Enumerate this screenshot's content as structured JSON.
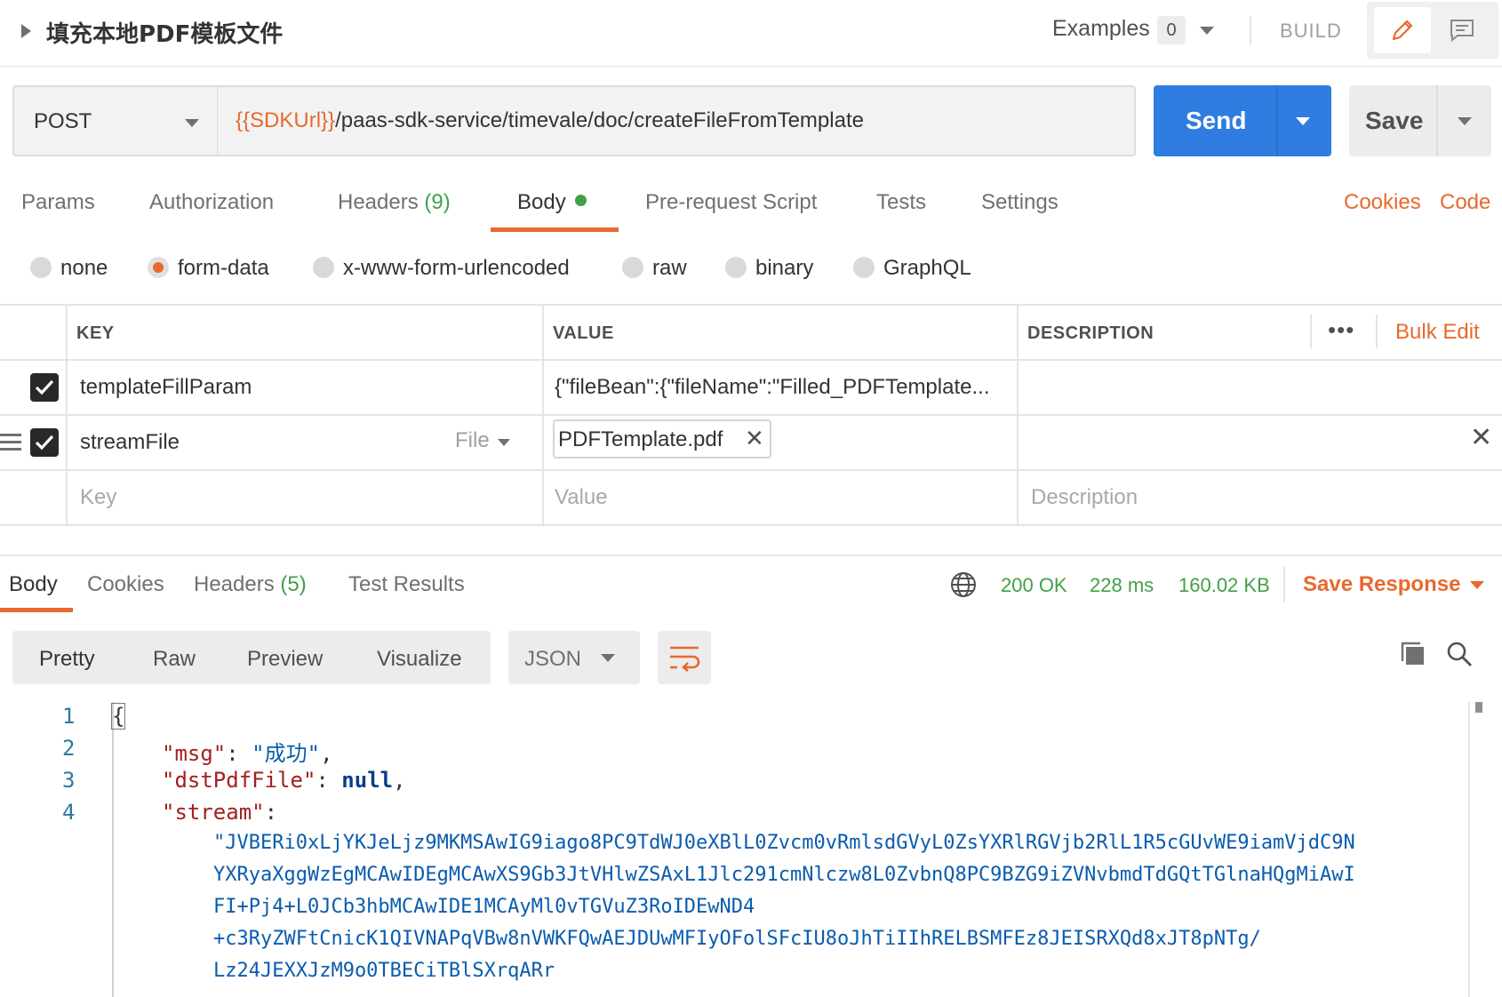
{
  "header": {
    "request_name": "填充本地PDF模板文件",
    "examples_label": "Examples",
    "examples_count": "0",
    "build_label": "BUILD"
  },
  "request": {
    "method": "POST",
    "url_variable": "{{SDKUrl}}",
    "url_path": "/paas-sdk-service/timevale/doc/createFileFromTemplate",
    "send_label": "Send",
    "save_label": "Save"
  },
  "request_tabs": {
    "params": "Params",
    "authorization": "Authorization",
    "headers": "Headers",
    "headers_count": "(9)",
    "body": "Body",
    "prerequest": "Pre-request Script",
    "tests": "Tests",
    "settings": "Settings",
    "cookies": "Cookies",
    "code": "Code"
  },
  "body_types": {
    "none": "none",
    "form_data": "form-data",
    "urlencoded": "x-www-form-urlencoded",
    "raw": "raw",
    "binary": "binary",
    "graphql": "GraphQL",
    "selected": "form-data"
  },
  "form_table": {
    "headers": {
      "key": "KEY",
      "value": "VALUE",
      "description": "DESCRIPTION"
    },
    "more_label": "•••",
    "bulk_edit": "Bulk Edit",
    "rows": [
      {
        "key": "templateFillParam",
        "value": "{\"fileBean\":{\"fileName\":\"Filled_PDFTemplate...",
        "checked": true
      },
      {
        "key": "streamFile",
        "type": "File",
        "file_name": "PDFTemplate.pdf",
        "checked": true
      }
    ],
    "placeholders": {
      "key": "Key",
      "value": "Value",
      "description": "Description"
    }
  },
  "response": {
    "tabs": {
      "body": "Body",
      "cookies": "Cookies",
      "headers": "Headers",
      "headers_count": "(5)",
      "test_results": "Test Results"
    },
    "status": "200 OK",
    "time": "228 ms",
    "size": "160.02 KB",
    "save_response": "Save Response",
    "views": {
      "pretty": "Pretty",
      "raw": "Raw",
      "preview": "Preview",
      "visualize": "Visualize"
    },
    "format": "JSON",
    "code": {
      "line_numbers": [
        "1",
        "2",
        "3",
        "4"
      ],
      "open_brace": "{",
      "msg_key": "\"msg\"",
      "msg_value": "\"成功\"",
      "dst_key": "\"dstPdfFile\"",
      "dst_value": "null",
      "stream_key": "\"stream\"",
      "stream_lines": [
        "\"JVBERi0xLjYKJeLjz9MKMSAwIG9iago8PC9TdWJ0eXBlL0Zvcm0vRmlsdGVyL0ZsYXRlRGVjb2RlL1R5cGUvWE9iamVjdC9N",
        "YXRyaXggWzEgMCAwIDEgMCAwXS9Gb3JtVHlwZSAxL1Jlc291cmNlczw8L0ZvbnQ8PC9BZG9iZVNvbmdTdGQtTGlnaHQgMiAwI",
        "FI+Pj4+L0JCb3hbMCAwIDE1MCAyMl0vTGVuZ3RoIDEwND4",
        "+c3RyZWFtCnicK1QIVNAPqVBw8nVWKFQwAEJDUwMFIyOFolSFcIU8oJhTiIIhRELBSMFEz8JEISRXQd8xJT8pNTg/",
        "Lz24JEXXJzM9o0TBECiTBlSXrqARr"
      ]
    }
  },
  "colors": {
    "accent": "#e8692d",
    "send": "#2f7de1",
    "success": "#43a047"
  }
}
